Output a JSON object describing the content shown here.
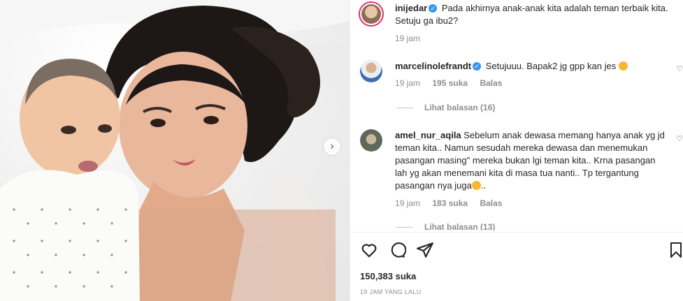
{
  "post": {
    "author": "inijedar",
    "caption": "Pada akhirnya anak-anak kita adalah teman terbaik kita. Setuju ga ibu2?",
    "time": "19 jam"
  },
  "comments": [
    {
      "user": "marcelinolefrandt",
      "verified": true,
      "text": "Setujuuu. Bapak2 jg gpp kan jes ",
      "emoji": "smiling-face-emoji",
      "time": "19 jam",
      "likes": "195 suka",
      "reply_label": "Balas",
      "view_replies": "Lihat balasan (16)"
    },
    {
      "user": "amel_nur_aqila",
      "verified": false,
      "text": "Sebelum anak dewasa memang hanya anak yg jd teman kita.. Namun sesudah mereka dewasa dan menemukan pasangan masing\" mereka bukan lgi teman kita.. Krna pasangan lah yg akan menemani kita di masa tua nanti.. Tp tergantung pasangan nya juga",
      "text_suffix": "..",
      "emoji": "smiling-face-emoji",
      "time": "19 jam",
      "likes": "183 suka",
      "reply_label": "Balas",
      "view_replies": "Lihat balasan (13)"
    }
  ],
  "footer": {
    "likes": "150,383 suka",
    "timestamp": "19 JAM YANG LALU"
  },
  "icons": {
    "like": "heart-icon",
    "comment": "comment-icon",
    "share": "paper-plane-icon",
    "save": "bookmark-icon",
    "next": "chevron-right-icon"
  },
  "colors": {
    "verified": "#3897f0",
    "muted": "#8e8e8e",
    "text": "#262626"
  }
}
